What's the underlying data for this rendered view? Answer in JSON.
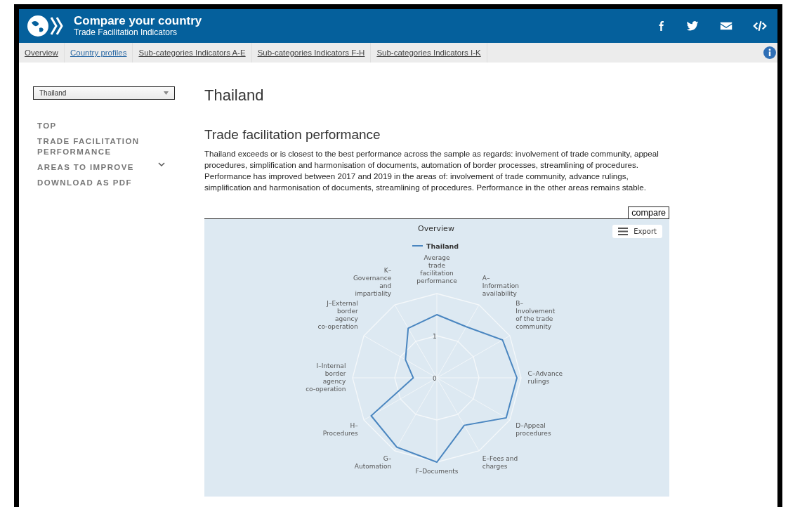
{
  "header": {
    "title": "Compare your country",
    "subtitle": "Trade Facilitation Indicators"
  },
  "nav": [
    {
      "label": "Overview",
      "selected": false
    },
    {
      "label": "Country profiles",
      "selected": true
    },
    {
      "label": "Sub-categories Indicators A-E",
      "selected": false
    },
    {
      "label": "Sub-categories Indicators F-H",
      "selected": false
    },
    {
      "label": "Sub-categories Indicators I-K",
      "selected": false
    }
  ],
  "country_select": {
    "value": "Thailand"
  },
  "sidebar": {
    "items": [
      {
        "label": "TOP",
        "expandable": false
      },
      {
        "label": "TRADE FACILITATION PERFORMANCE",
        "expandable": false
      },
      {
        "label": "AREAS TO IMPROVE",
        "expandable": true
      },
      {
        "label": "DOWNLOAD AS PDF",
        "expandable": false
      }
    ]
  },
  "country_title": "Thailand",
  "section_title": "Trade facilitation performance",
  "summary": "Thailand exceeds or is closest to the best performance across the sample as regards: involvement of trade community, appeal procedures, simplification and harmonisation of documents, automation of border processes, streamlining of procedures. Performance has improved between 2017 and 2019 in the areas of: involvement of trade community, advance rulings, simplification and harmonisation of documents, streamlining of procedures. Performance in the other areas remains stable.",
  "compare_button": "compare",
  "export_button": "Export",
  "radar_chart": {
    "title": "Overview",
    "legend": "Thailand",
    "ticks": [
      "1",
      "0"
    ],
    "axes": [
      {
        "label": "Average trade facilitation performance"
      },
      {
        "label": "K–Governance and impartiality"
      },
      {
        "label": "A–Information availability"
      },
      {
        "label": "J–External border agency co-operation"
      },
      {
        "label": "B–Involvement of the trade community"
      },
      {
        "label": "I–Internal border agency co-operation"
      },
      {
        "label": "C–Advance rulings"
      },
      {
        "label": "H–Procedures"
      },
      {
        "label": "D–Appeal procedures"
      },
      {
        "label": "G–Automation"
      },
      {
        "label": "E–Fees and charges"
      },
      {
        "label": "F–Documents"
      }
    ]
  }
}
